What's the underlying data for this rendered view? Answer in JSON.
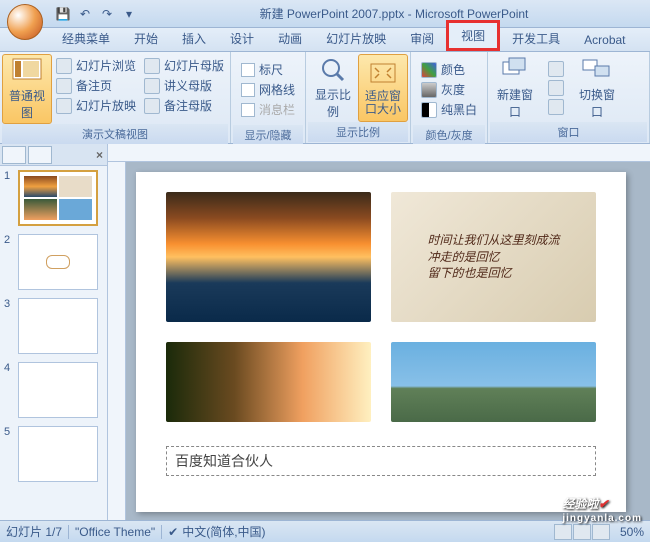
{
  "title": "新建 PowerPoint 2007.pptx - Microsoft PowerPoint",
  "tabs": {
    "classic": "经典菜单",
    "home": "开始",
    "insert": "插入",
    "design": "设计",
    "anim": "动画",
    "show": "幻灯片放映",
    "review": "审阅",
    "view": "视图",
    "dev": "开发工具",
    "acrobat": "Acrobat"
  },
  "ribbon": {
    "g1": {
      "label": "演示文稿视图",
      "normal": "普通视图",
      "browse": "幻灯片浏览",
      "notes": "备注页",
      "show": "幻灯片放映",
      "master": "幻灯片母版",
      "handout": "讲义母版",
      "notesmaster": "备注母版"
    },
    "g2": {
      "label": "显示/隐藏",
      "ruler": "标尺",
      "grid": "网格线",
      "msgbar": "消息栏"
    },
    "g3": {
      "label": "显示比例",
      "zoom": "显示比例",
      "fit": "适应窗口大小"
    },
    "g4": {
      "label": "颜色/灰度",
      "color": "颜色",
      "gray": "灰度",
      "bw": "纯黑白"
    },
    "g5": {
      "label": "窗口",
      "newwin": "新建窗口",
      "switch": "切换窗口"
    }
  },
  "thumbs": [
    "1",
    "2",
    "3",
    "4",
    "5"
  ],
  "textbox": "百度知道合伙人",
  "status": {
    "slide": "幻灯片 1/7",
    "theme": "\"Office Theme\"",
    "lang": "中文(简体,中国)",
    "zoom": "50%"
  },
  "pic2_lines": "时间让我们从这里刻成流\n冲走的是回忆\n留下的也是回忆",
  "watermark": {
    "main": "经验啦",
    "sub": "jingyanla.com"
  }
}
